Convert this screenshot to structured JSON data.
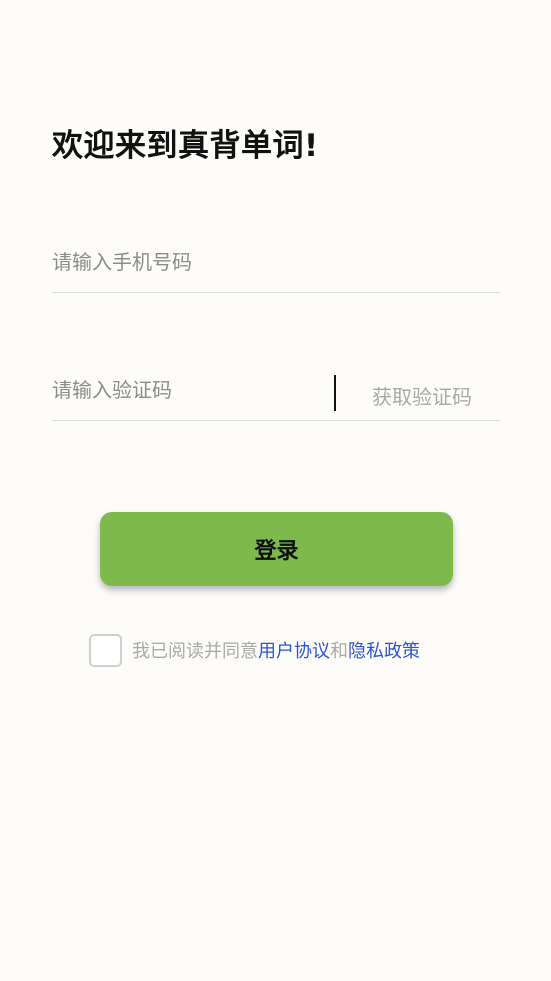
{
  "welcome": {
    "title": "欢迎来到真背单词!"
  },
  "login_form": {
    "phone_placeholder": "请输入手机号码",
    "code_placeholder": "请输入验证码",
    "get_code_label": "获取验证码",
    "login_label": "登录"
  },
  "agreement": {
    "prefix": "我已阅读并同意",
    "user_agreement": "用户协议",
    "joiner": "和",
    "privacy_policy": "隐私政策",
    "checked": false
  },
  "colors": {
    "background": "#fdfcf8",
    "login_button": "#7dba4b",
    "link": "#2b55d1",
    "muted_text": "#a9a9a9"
  }
}
